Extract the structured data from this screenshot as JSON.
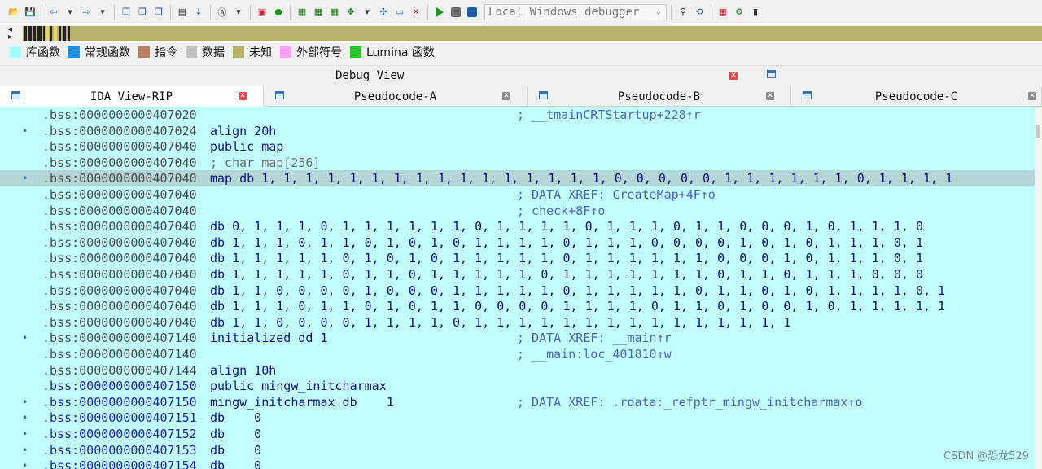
{
  "toolbar": {
    "debugger_label": "Local Windows debugger"
  },
  "legend": [
    {
      "label": "库函数",
      "color": "#a6ffff"
    },
    {
      "label": "常规函数",
      "color": "#1d8fe6"
    },
    {
      "label": "指令",
      "color": "#b97f64"
    },
    {
      "label": "数据",
      "color": "#c0c0c0"
    },
    {
      "label": "未知",
      "color": "#b7b26c"
    },
    {
      "label": "外部符号",
      "color": "#ff9dfa"
    },
    {
      "label": "Lumina 函数",
      "color": "#26c726"
    }
  ],
  "debug_view": {
    "title": "Debug View"
  },
  "tabs": [
    {
      "label": "IDA View-RIP"
    },
    {
      "label": "Pseudocode-A"
    },
    {
      "label": "Pseudocode-B"
    },
    {
      "label": "Pseudocode-C"
    }
  ],
  "listing": [
    {
      "seg": ".bss:",
      "addr": "0000000000407020",
      "code": "",
      "comment": "; __tmainCRTStartup+228↑r",
      "dot": false
    },
    {
      "seg": ".bss:",
      "addr": "0000000000407024",
      "code": "align 20h",
      "comment": "",
      "dot": true
    },
    {
      "seg": ".bss:",
      "addr": "0000000000407040",
      "code": "public map",
      "comment": "",
      "dot": false
    },
    {
      "seg": ".bss:",
      "addr": "0000000000407040",
      "code": "; char map[256]",
      "comment": "",
      "dot": false,
      "grey": true
    },
    {
      "seg": ".bss:",
      "addr": "0000000000407040",
      "code": "map db 1, 1, 1, 1, 1, 1, 1, 1, 1, 1, 1, 1, 1, 1, 1, 1, 0, 0, 0, 0, 0, 1, 1, 1, 1, 1, 1, 0, 1, 1, 1, 1",
      "comment": "",
      "dot": true,
      "selected": true
    },
    {
      "seg": ".bss:",
      "addr": "0000000000407040",
      "code": "",
      "comment": "; DATA XREF: CreateMap+4F↑o",
      "dot": false
    },
    {
      "seg": ".bss:",
      "addr": "0000000000407040",
      "code": "",
      "comment": "; check+8F↑o",
      "dot": false
    },
    {
      "seg": ".bss:",
      "addr": "0000000000407040",
      "code": "db 0, 1, 1, 1, 0, 1, 1, 1, 1, 1, 1, 0, 1, 1, 1, 1, 0, 1, 1, 1, 0, 1, 1, 0, 0, 0, 1, 0, 1, 1, 1, 0",
      "comment": "",
      "dot": false
    },
    {
      "seg": ".bss:",
      "addr": "0000000000407040",
      "code": "db 1, 1, 1, 0, 1, 1, 0, 1, 0, 1, 0, 1, 1, 1, 1, 0, 1, 1, 1, 0, 0, 0, 0, 1, 0, 1, 0, 1, 1, 1, 0, 1",
      "comment": "",
      "dot": false
    },
    {
      "seg": ".bss:",
      "addr": "0000000000407040",
      "code": "db 1, 1, 1, 1, 1, 0, 1, 0, 1, 0, 1, 1, 1, 1, 1, 0, 1, 1, 1, 1, 1, 1, 0, 0, 0, 1, 0, 1, 1, 1, 0, 1",
      "comment": "",
      "dot": false
    },
    {
      "seg": ".bss:",
      "addr": "0000000000407040",
      "code": "db 1, 1, 1, 1, 1, 0, 1, 1, 0, 1, 1, 1, 1, 1, 0, 1, 1, 1, 1, 1, 1, 1, 0, 1, 1, 0, 1, 1, 1, 0, 0, 0",
      "comment": "",
      "dot": false
    },
    {
      "seg": ".bss:",
      "addr": "0000000000407040",
      "code": "db 1, 1, 0, 0, 0, 0, 1, 0, 0, 0, 1, 1, 1, 1, 1, 0, 1, 1, 1, 1, 1, 0, 1, 1, 0, 1, 0, 1, 1, 1, 1, 0, 1",
      "comment": "",
      "dot": false
    },
    {
      "seg": ".bss:",
      "addr": "0000000000407040",
      "code": "db 1, 1, 1, 0, 1, 1, 0, 1, 0, 1, 1, 0, 0, 0, 0, 1, 1, 1, 1, 0, 1, 1, 0, 1, 0, 0, 1, 0, 1, 1, 1, 1, 1",
      "comment": "",
      "dot": false
    },
    {
      "seg": ".bss:",
      "addr": "0000000000407040",
      "code": "db 1, 1, 0, 0, 0, 0, 1, 1, 1, 1, 0, 1, 1, 1, 1, 1, 1, 1, 1, 1, 1, 1, 1, 1, 1, 1",
      "comment": "",
      "dot": false
    },
    {
      "seg": ".bss:",
      "addr": "0000000000407140",
      "code": "initialized dd 1",
      "comment": "; DATA XREF: __main↑r",
      "dot": true
    },
    {
      "seg": ".bss:",
      "addr": "0000000000407140",
      "code": "",
      "comment": "; __main:loc_401810↑w",
      "dot": false
    },
    {
      "seg": ".bss:",
      "addr": "0000000000407144",
      "code": "align 10h",
      "comment": "",
      "dot": false
    },
    {
      "seg": ".bss:",
      "addr": "0000000000407150",
      "code": "public mingw_initcharmax",
      "comment": "",
      "dot": false,
      "hl": true
    },
    {
      "seg": ".bss:",
      "addr": "0000000000407150",
      "code": "mingw_initcharmax db    1",
      "comment": "; DATA XREF: .rdata:_refptr_mingw_initcharmax↑o",
      "dot": true,
      "hl": true
    },
    {
      "seg": ".bss:",
      "addr": "0000000000407151",
      "code": "db    0",
      "comment": "",
      "dot": true,
      "hl": true
    },
    {
      "seg": ".bss:",
      "addr": "0000000000407152",
      "code": "db    0",
      "comment": "",
      "dot": true,
      "hl": true
    },
    {
      "seg": ".bss:",
      "addr": "0000000000407153",
      "code": "db    0",
      "comment": "",
      "dot": true,
      "hl": true
    },
    {
      "seg": ".bss:",
      "addr": "0000000000407154",
      "code": "db    0",
      "comment": "",
      "dot": true,
      "hl": true
    }
  ],
  "watermark": "CSDN @恐龙529"
}
